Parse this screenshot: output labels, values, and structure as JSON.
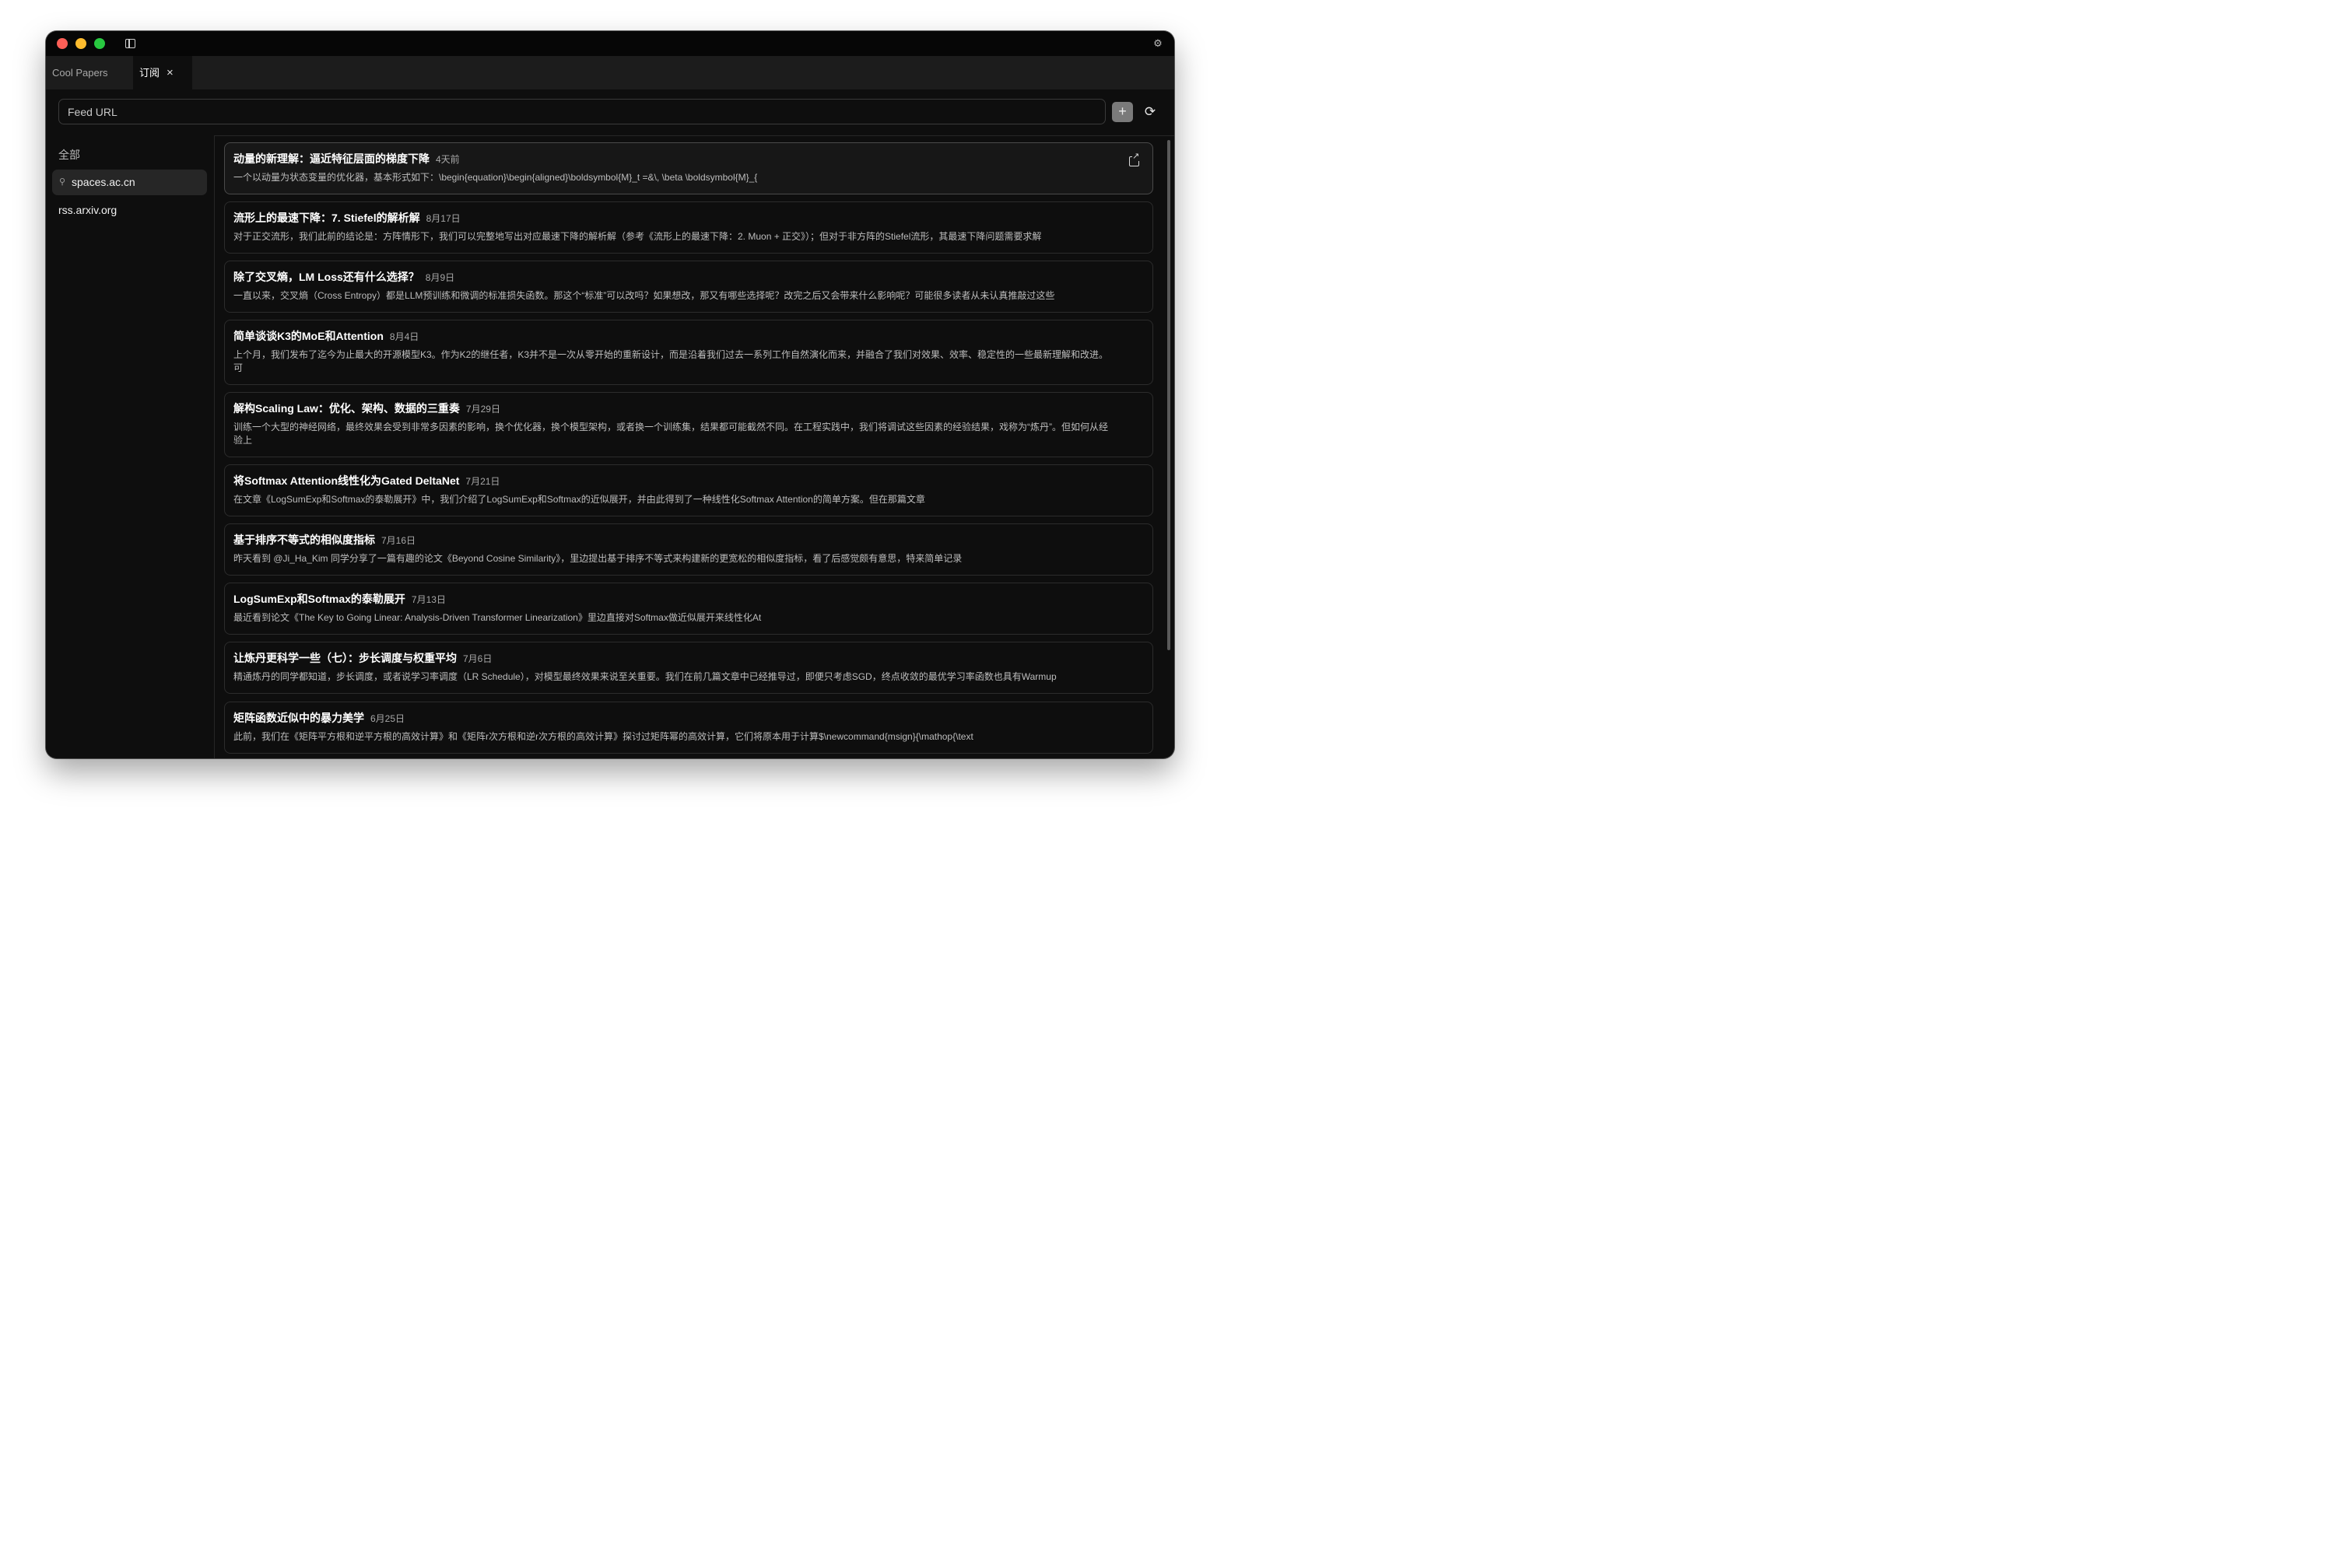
{
  "tabs": [
    {
      "label": "Cool Papers"
    },
    {
      "label": "订阅",
      "close": "×"
    }
  ],
  "toolbar": {
    "url_placeholder": "Feed URL",
    "add_label": "+",
    "refresh_label": "⟳"
  },
  "sidebar": {
    "all_label": "全部",
    "items": [
      {
        "label": "spaces.ac.cn",
        "pinned": true
      },
      {
        "label": "rss.arxiv.org",
        "pinned": false
      }
    ]
  },
  "articles": [
    {
      "title": "动量的新理解：逼近特征层面的梯度下降",
      "date": "4天前",
      "summary": "一个以动量为状态变量的优化器，基本形式如下：\\begin{equation}\\begin{aligned}\\boldsymbol{M}_t =&\\, \\beta \\boldsymbol{M}_{"
    },
    {
      "title": "流形上的最速下降：7. Stiefel的解析解",
      "date": "8月17日",
      "summary": "对于正交流形，我们此前的结论是：方阵情形下，我们可以完整地写出对应最速下降的解析解（参考《流形上的最速下降：2. Muon + 正交》）；但对于非方阵的Stiefel流形，其最速下降问题需要求解"
    },
    {
      "title": "除了交叉熵，LM Loss还有什么选择？",
      "date": "8月9日",
      "summary": "一直以来，交叉熵（Cross Entropy）都是LLM预训练和微调的标准损失函数。那这个“标准”可以改吗？如果想改，那又有哪些选择呢？改完之后又会带来什么影响呢？可能很多读者从未认真推敲过这些"
    },
    {
      "title": "简单谈谈K3的MoE和Attention",
      "date": "8月4日",
      "summary": "上个月，我们发布了迄今为止最大的开源模型K3。作为K2的继任者，K3并不是一次从零开始的重新设计，而是沿着我们过去一系列工作自然演化而来，并融合了我们对效果、效率、稳定性的一些最新理解和改进。可"
    },
    {
      "title": "解构Scaling Law：优化、架构、数据的三重奏",
      "date": "7月29日",
      "summary": "训练一个大型的神经网络，最终效果会受到非常多因素的影响，换个优化器，换个模型架构，或者换一个训练集，结果都可能截然不同。在工程实践中，我们将调试这些因素的经验结果，戏称为“炼丹”。但如何从经验上"
    },
    {
      "title": "将Softmax Attention线性化为Gated DeltaNet",
      "date": "7月21日",
      "summary": "在文章《LogSumExp和Softmax的泰勒展开》中，我们介绍了LogSumExp和Softmax的近似展开，并由此得到了一种线性化Softmax Attention的简单方案。但在那篇文章"
    },
    {
      "title": "基于排序不等式的相似度指标",
      "date": "7月16日",
      "summary": "昨天看到 @Ji_Ha_Kim 同学分享了一篇有趣的论文《Beyond Cosine Similarity》，里边提出基于排序不等式来构建新的更宽松的相似度指标，看了后感觉颇有意思，特来简单记录"
    },
    {
      "title": "LogSumExp和Softmax的泰勒展开",
      "date": "7月13日",
      "summary": "最近看到论文《The Key to Going Linear: Analysis-Driven Transformer Linearization》里边直接对Softmax做近似展开来线性化At"
    },
    {
      "title": "让炼丹更科学一些（七）：步长调度与权重平均",
      "date": "7月6日",
      "summary": "精通炼丹的同学都知道，步长调度，或者说学习率调度（LR Schedule），对模型最终效果来说至关重要。我们在前几篇文章中已经推导过，即便只考虑SGD，终点收敛的最优学习率函数也具有Warmup"
    },
    {
      "title": "矩阵函数近似中的暴力美学",
      "date": "6月25日",
      "summary": "此前，我们在《矩阵平方根和逆平方根的高效计算》和《矩阵r次方根和逆r次方根的高效计算》探讨过矩阵幂的高效计算，它们将原本用于计算$\\newcommand{msign}{\\mathop{\\text"
    }
  ],
  "icons": {
    "settings": "gear-icon",
    "sidebar_toggle": "sidebar-icon",
    "pin": "pin-icon",
    "external": "external-link-icon",
    "refresh": "refresh-icon",
    "add": "plus-icon"
  },
  "colors": {
    "window_bg": "#0e0e0e",
    "titlebar_bg": "#060606",
    "tabbar_bg": "#1c1c1c",
    "card_border": "#2c2c2c",
    "selected_card_bg": "#171717",
    "sidebar_active_bg": "#262626",
    "add_button_bg": "#7a7a7a"
  }
}
